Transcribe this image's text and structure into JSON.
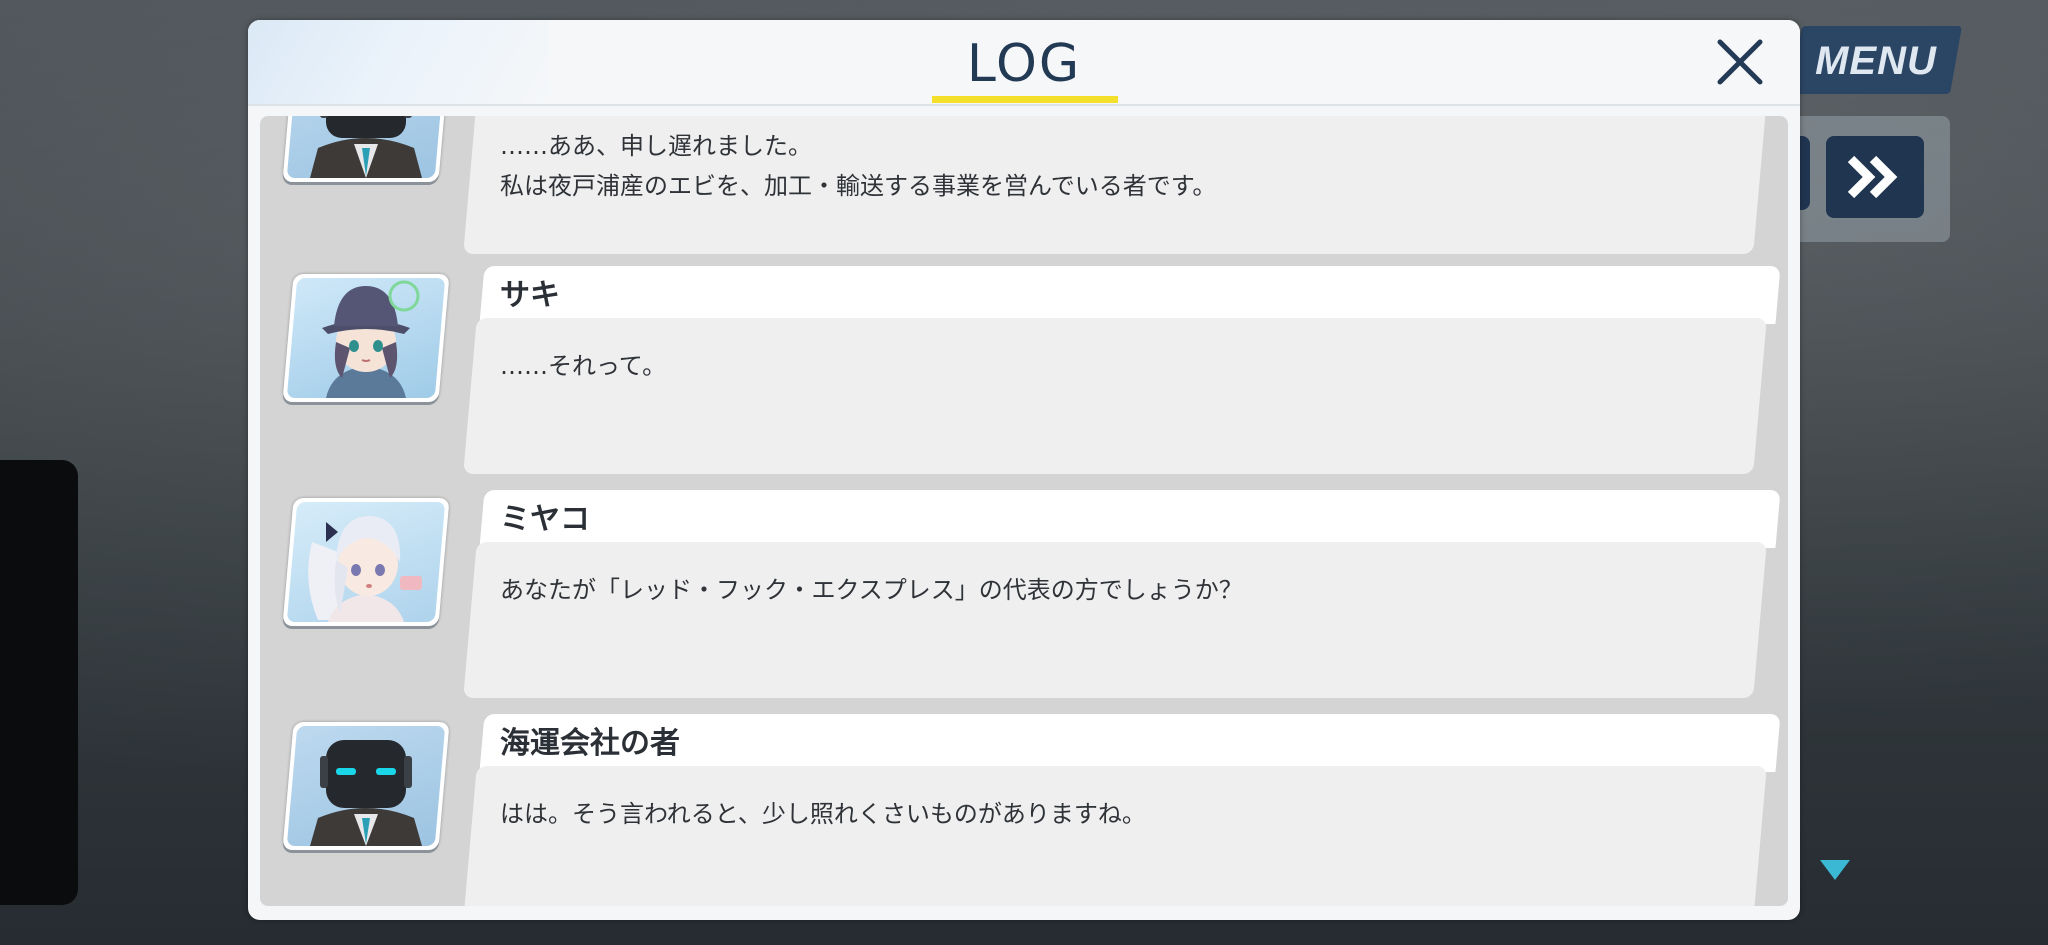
{
  "log": {
    "title": "LOG",
    "close_label": "×",
    "entries": [
      {
        "speaker": "",
        "portrait": "robot",
        "lines": [
          "……ああ、申し遅れました。",
          "私は夜戸浦産のエビを、加工・輸送する事業を営んでいる者です。"
        ]
      },
      {
        "speaker": "サキ",
        "portrait": "saki",
        "lines": [
          "……それって。"
        ]
      },
      {
        "speaker": "ミヤコ",
        "portrait": "miyako",
        "lines": [
          "あなたが「レッド・フック・エクスプレス」の代表の方でしょうか？"
        ]
      },
      {
        "speaker": "海運会社の者",
        "portrait": "robot",
        "lines": [
          "はは。そう言われると、少し照れくさいものがありますね。"
        ]
      }
    ]
  },
  "hud": {
    "menu_label": "MENU",
    "fast_forward_icon": "double-chevron-right-icon",
    "scroll_indicator_icon": "triangle-down-icon"
  },
  "colors": {
    "accent_yellow": "#f4e02a",
    "title_navy": "#233a55",
    "button_navy": "#1f3550",
    "robot_eye_cyan": "#19d6e8"
  }
}
